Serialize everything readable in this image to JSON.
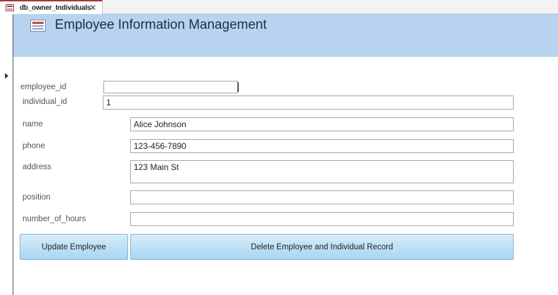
{
  "tab": {
    "label": "db_owner_Individuals",
    "close": "✕"
  },
  "header": {
    "title": "Employee Information Management"
  },
  "form": {
    "employee_id": {
      "label": "employee_id",
      "value": ""
    },
    "individual_id": {
      "label": "individual_id",
      "value": "1"
    },
    "name": {
      "label": "name",
      "value": "Alice Johnson"
    },
    "phone": {
      "label": "phone",
      "value": "123-456-7890"
    },
    "address": {
      "label": "address",
      "value": "123 Main St"
    },
    "position": {
      "label": "position",
      "value": ""
    },
    "number_of_hours": {
      "label": "number_of_hours",
      "value": ""
    }
  },
  "buttons": {
    "update": "Update Employee",
    "delete": "Delete Employee and Individual Record"
  },
  "colors": {
    "header_bg": "#b8d3ef",
    "tab_accent": "#a4373a",
    "button_bg": "#a9d6f2"
  },
  "icons": {
    "tab": "form-icon",
    "header": "form-icon",
    "record_selector": "triangle-right-icon"
  }
}
